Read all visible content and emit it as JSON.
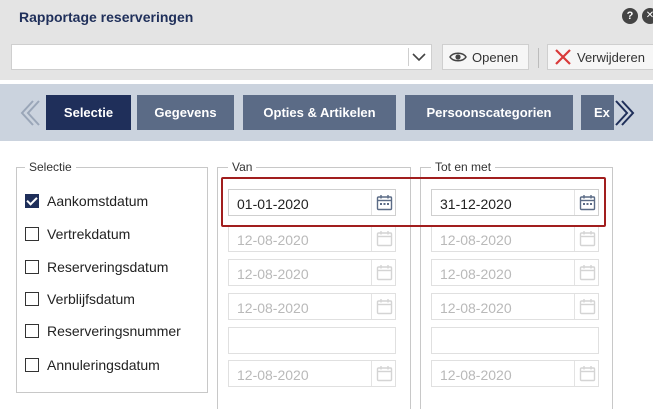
{
  "header": {
    "title": "Rapportage reserveringen",
    "help_glyph": "?",
    "close_glyph": "✕"
  },
  "toolbar": {
    "report_select_value": "",
    "open_label": "Openen",
    "delete_label": "Verwijderen"
  },
  "tabs": [
    {
      "label": "Selectie",
      "active": true
    },
    {
      "label": "Gegevens",
      "active": false
    },
    {
      "label": "Opties & Artikelen",
      "active": false
    },
    {
      "label": "Persoonscategorien",
      "active": false
    },
    {
      "label": "Ex",
      "active": false
    }
  ],
  "selection": {
    "legend": "Selectie",
    "items": [
      {
        "label": "Aankomstdatum",
        "checked": true
      },
      {
        "label": "Vertrekdatum",
        "checked": false
      },
      {
        "label": "Reserveringsdatum",
        "checked": false
      },
      {
        "label": "Verblijfsdatum",
        "checked": false
      },
      {
        "label": "Reserveringsnummer",
        "checked": false
      },
      {
        "label": "Annuleringsdatum",
        "checked": false
      }
    ]
  },
  "from": {
    "legend": "Van",
    "values": [
      "01-01-2020",
      "12-08-2020",
      "12-08-2020",
      "12-08-2020",
      "",
      "12-08-2020"
    ]
  },
  "to": {
    "legend": "Tot en met",
    "values": [
      "31-12-2020",
      "12-08-2020",
      "12-08-2020",
      "12-08-2020",
      "",
      "12-08-2020"
    ]
  },
  "colors": {
    "primary": "#1f2f5a",
    "tab": "#5b6b86",
    "strip": "#cbd3de",
    "highlight": "#a11e1e",
    "delete": "#d93a3a"
  }
}
